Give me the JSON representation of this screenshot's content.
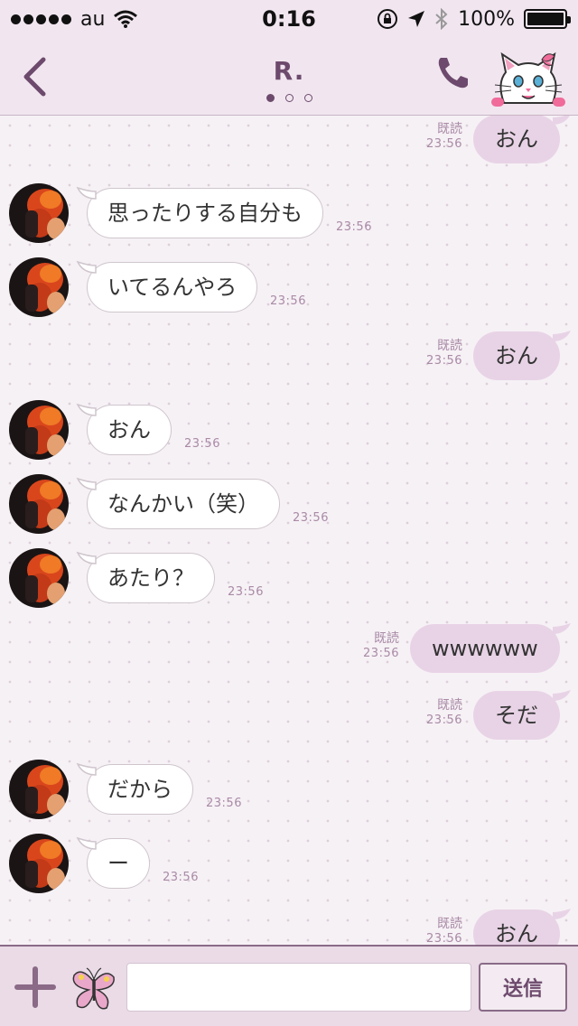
{
  "status_bar": {
    "carrier": "au",
    "time": "0:16",
    "battery": "100%"
  },
  "header": {
    "title": "R.",
    "page_count": 3,
    "active_page": 1
  },
  "messages": [
    {
      "side": "out",
      "text": "おん",
      "read": "既読",
      "time": "23:56"
    },
    {
      "side": "in",
      "text": "思ったりする自分も",
      "time": "23:56"
    },
    {
      "side": "in",
      "text": "いてるんやろ",
      "time": "23:56"
    },
    {
      "side": "out",
      "text": "おん",
      "read": "既読",
      "time": "23:56"
    },
    {
      "side": "in",
      "text": "おん",
      "time": "23:56"
    },
    {
      "side": "in",
      "text": "なんかい（笑）",
      "time": "23:56"
    },
    {
      "side": "in",
      "text": "あたり？",
      "time": "23:56"
    },
    {
      "side": "out",
      "text": "wwwwww",
      "read": "既読",
      "time": "23:56"
    },
    {
      "side": "out",
      "text": "そだ",
      "read": "既読",
      "time": "23:56"
    },
    {
      "side": "in",
      "text": "だから",
      "time": "23:56"
    },
    {
      "side": "in",
      "text": "ー",
      "time": "23:56"
    },
    {
      "side": "out",
      "text": "おん",
      "read": "既読",
      "time": "23:56"
    }
  ],
  "input": {
    "placeholder": "",
    "send_label": "送信"
  },
  "icons": {
    "back": "chevron-left-icon",
    "phone": "phone-icon",
    "cat": "cat-sticker-icon",
    "plus": "plus-icon",
    "butterfly": "butterfly-icon",
    "wifi": "wifi-icon",
    "location": "location-icon",
    "bluetooth": "bluetooth-icon",
    "rotation_lock": "rotation-lock-icon"
  },
  "colors": {
    "accent": "#6d4a6d",
    "bubble_out": "#e8d3e6",
    "bubble_in": "#ffffff",
    "background": "#f6f1f5"
  }
}
